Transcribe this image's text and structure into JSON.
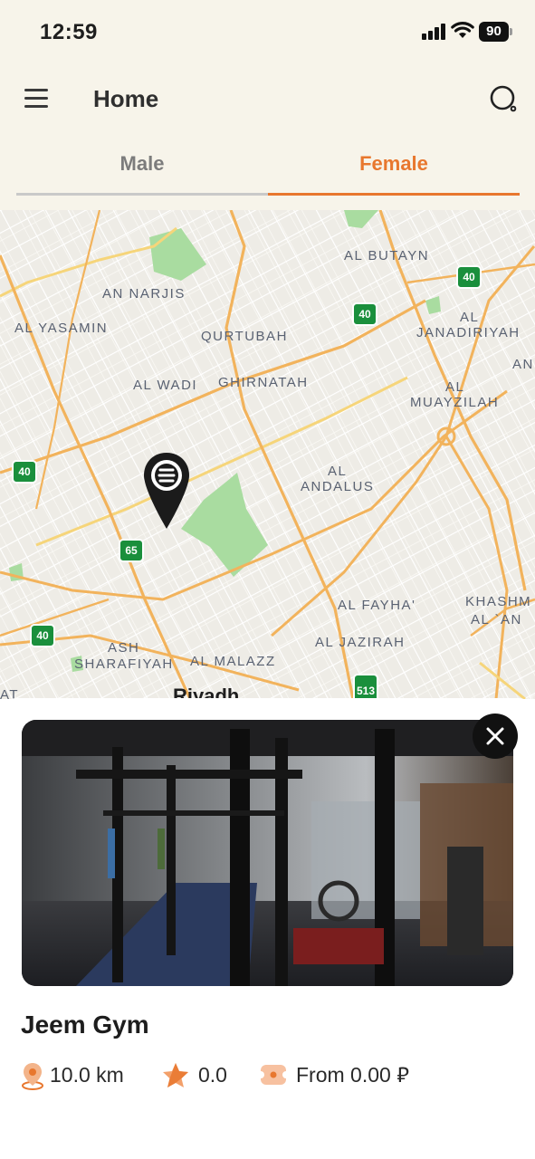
{
  "status_bar": {
    "time": "12:59",
    "battery": "90"
  },
  "header": {
    "title": "Home"
  },
  "tabs": [
    {
      "label": "Male",
      "selected": false
    },
    {
      "label": "Female",
      "selected": true
    }
  ],
  "map": {
    "labels": {
      "al_butayn": "AL BUTAYN",
      "an_narjis": "AN NARJIS",
      "al_yasamin": "AL YASAMIN",
      "qurtubah": "QURTUBAH",
      "al_janadiriyah_1": "AL",
      "al_janadiriyah_2": "JANADIRIYAH",
      "an": "AN",
      "al_wadi": "AL WADI",
      "ghirnatah": "GHIRNATAH",
      "al_muayzilah_1": "AL",
      "al_muayzilah_2": "MUAYZILAH",
      "al_andalus_1": "AL",
      "al_andalus_2": "ANDALUS",
      "al_fayha": "AL FAYHA'",
      "khashm_1": "KHASHM",
      "khashm_2": "AL `AN",
      "al_jazirah": "AL JAZIRAH",
      "ash_sharafiyah_1": "ASH",
      "ash_sharafiyah_2": "SHARAFIYAH",
      "al_malazz": "AL MALAZZ",
      "at": "AT",
      "city": "Riyadh"
    },
    "shields": [
      "40",
      "40",
      "40",
      "40",
      "65",
      "513"
    ]
  },
  "gym": {
    "name": "Jeem Gym",
    "distance": "10.0 km",
    "rating": "0.0",
    "price": "From 0.00 ⃁"
  },
  "colors": {
    "accent": "#e8772e",
    "header_bg": "#f7f4ea",
    "road": "#f2b35c",
    "park": "#a9dca0"
  },
  "icons": [
    "menu-icon",
    "search-icon",
    "close-icon",
    "location-pin-icon",
    "star-icon",
    "ticket-icon",
    "map-marker-icon"
  ]
}
